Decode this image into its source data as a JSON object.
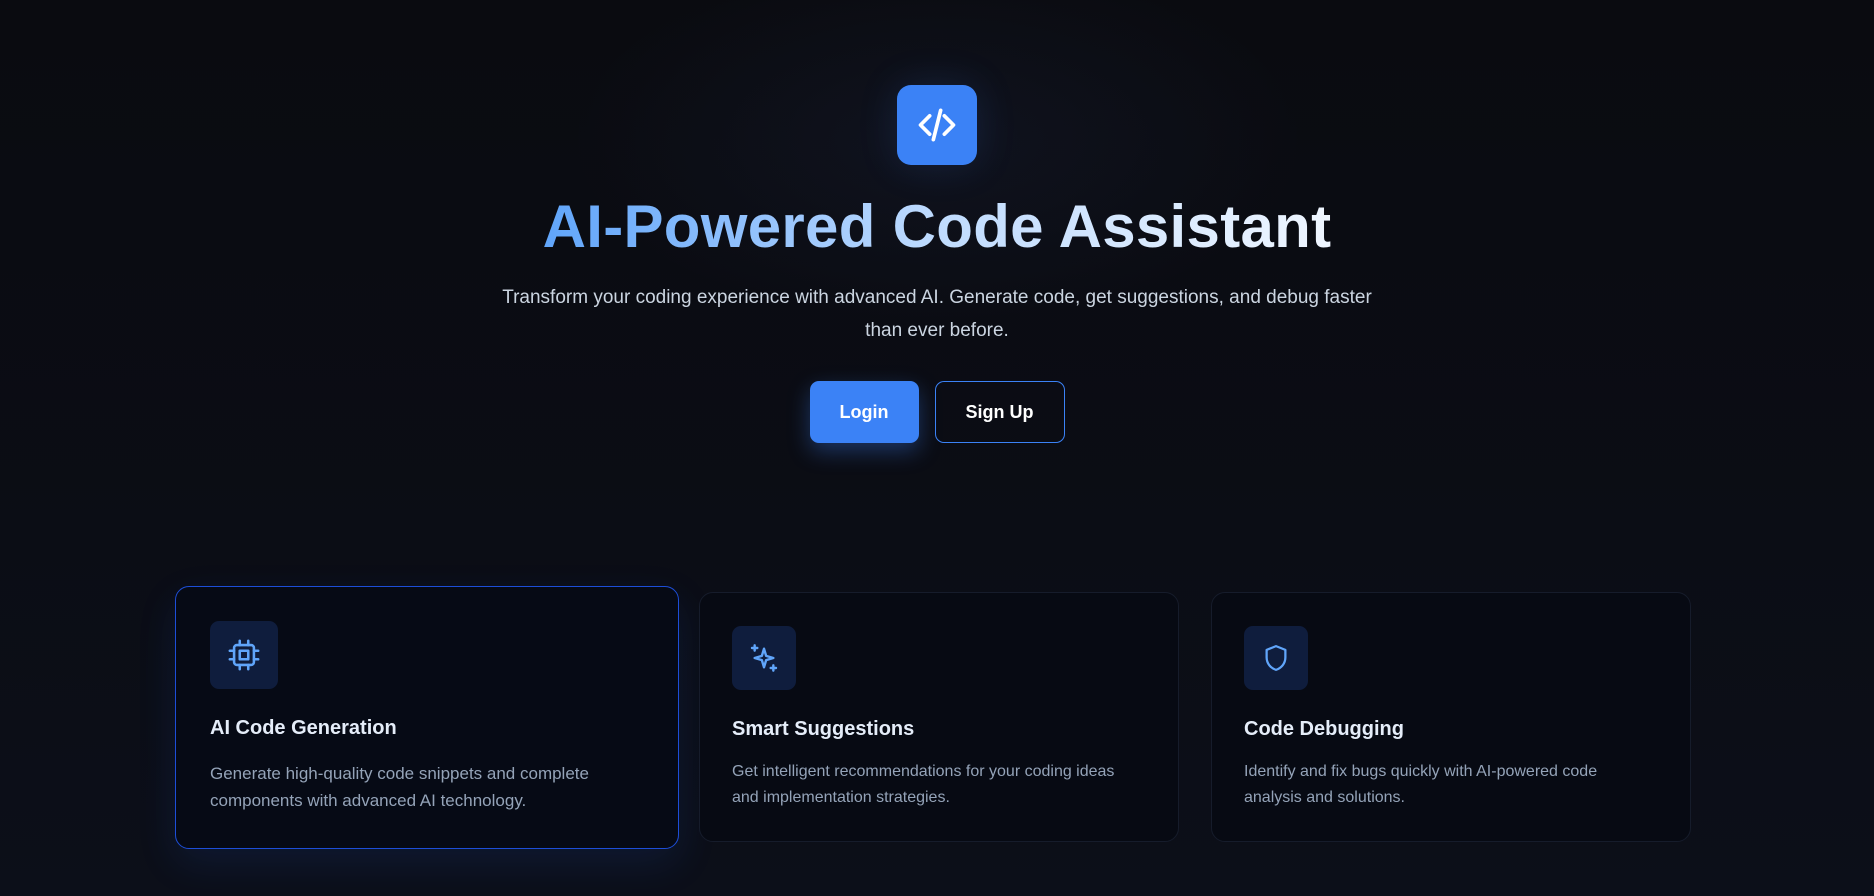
{
  "hero": {
    "logo_icon": "code-brackets-icon",
    "title": "AI-Powered Code Assistant",
    "subtitle": "Transform your coding experience with advanced AI. Generate code, get suggestions, and debug faster than ever before.",
    "login_label": "Login",
    "signup_label": "Sign Up"
  },
  "features": [
    {
      "icon": "cpu-chip-icon",
      "title": "AI Code Generation",
      "description": "Generate high-quality code snippets and complete components with advanced AI technology."
    },
    {
      "icon": "sparkles-icon",
      "title": "Smart Suggestions",
      "description": "Get intelligent recommendations for your coding ideas and implementation strategies."
    },
    {
      "icon": "shield-icon",
      "title": "Code Debugging",
      "description": "Identify and fix bugs quickly with AI-powered code analysis and solutions."
    }
  ],
  "colors": {
    "accent": "#3b82f6",
    "background": "#0a0b10",
    "card_background": "#070a13",
    "icon_tile": "#0f1d3d"
  }
}
